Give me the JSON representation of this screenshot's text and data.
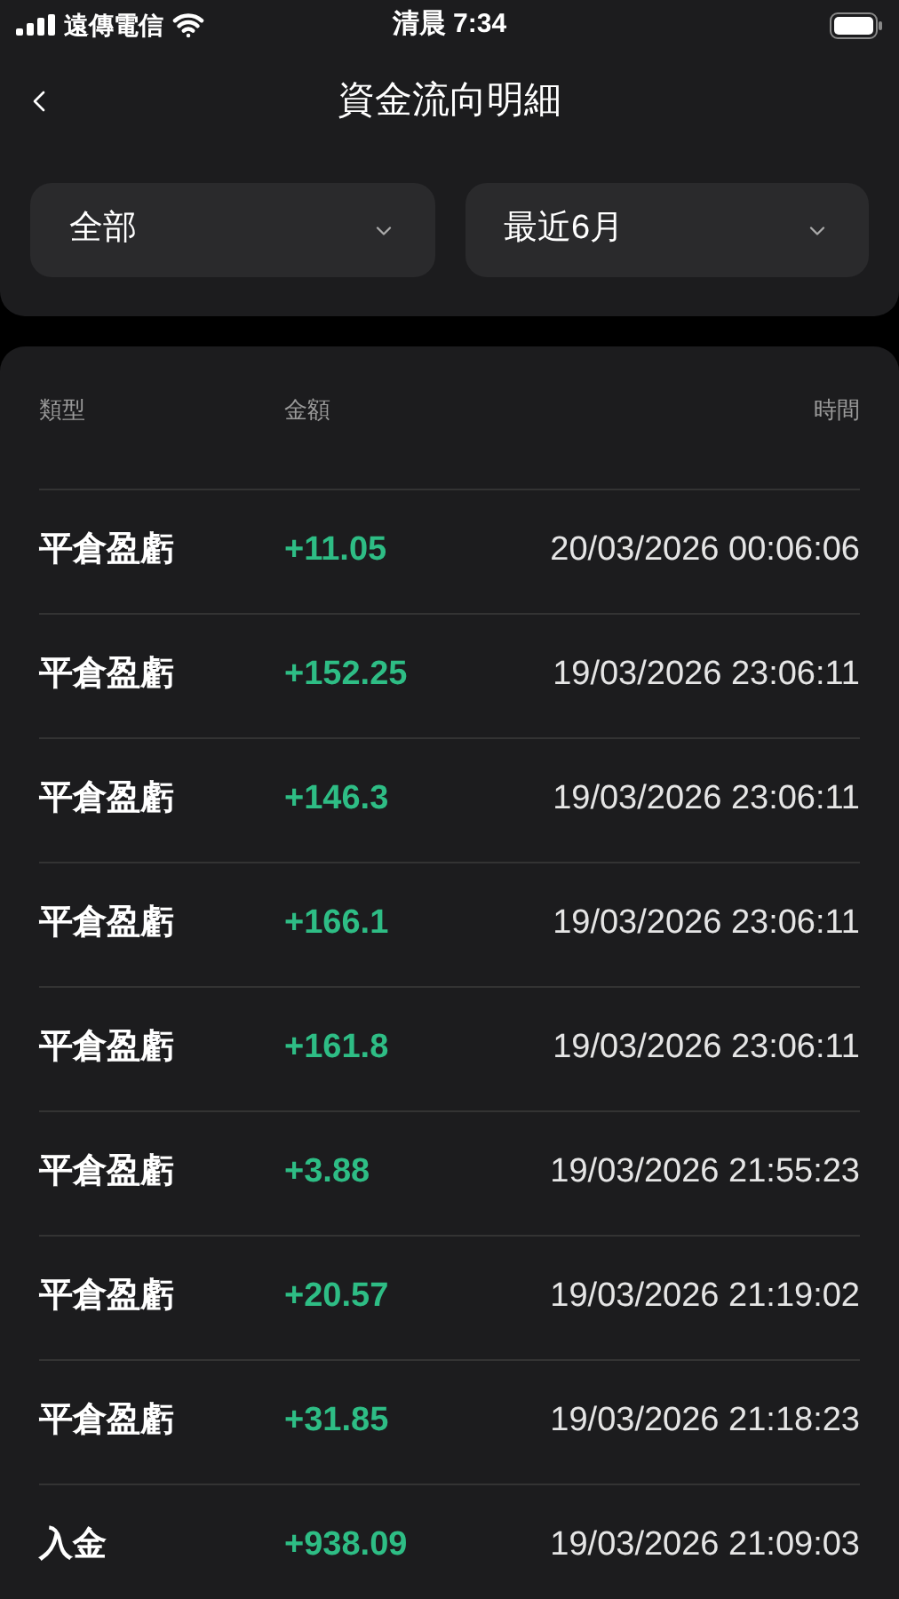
{
  "status_bar": {
    "carrier": "遠傳電信",
    "time": "清晨 7:34"
  },
  "header": {
    "title": "資金流向明細"
  },
  "filters": [
    {
      "label": "全部"
    },
    {
      "label": "最近6月"
    }
  ],
  "table": {
    "columns": [
      "類型",
      "金額",
      "時間"
    ],
    "rows": [
      {
        "type": "平倉盈虧",
        "amount": "+11.05",
        "time": "20/03/2026 00:06:06"
      },
      {
        "type": "平倉盈虧",
        "amount": "+152.25",
        "time": "19/03/2026 23:06:11"
      },
      {
        "type": "平倉盈虧",
        "amount": "+146.3",
        "time": "19/03/2026 23:06:11"
      },
      {
        "type": "平倉盈虧",
        "amount": "+166.1",
        "time": "19/03/2026 23:06:11"
      },
      {
        "type": "平倉盈虧",
        "amount": "+161.8",
        "time": "19/03/2026 23:06:11"
      },
      {
        "type": "平倉盈虧",
        "amount": "+3.88",
        "time": "19/03/2026 21:55:23"
      },
      {
        "type": "平倉盈虧",
        "amount": "+20.57",
        "time": "19/03/2026 21:19:02"
      },
      {
        "type": "平倉盈虧",
        "amount": "+31.85",
        "time": "19/03/2026 21:18:23"
      },
      {
        "type": "入金",
        "amount": "+938.09",
        "time": "19/03/2026 21:09:03"
      }
    ]
  }
}
